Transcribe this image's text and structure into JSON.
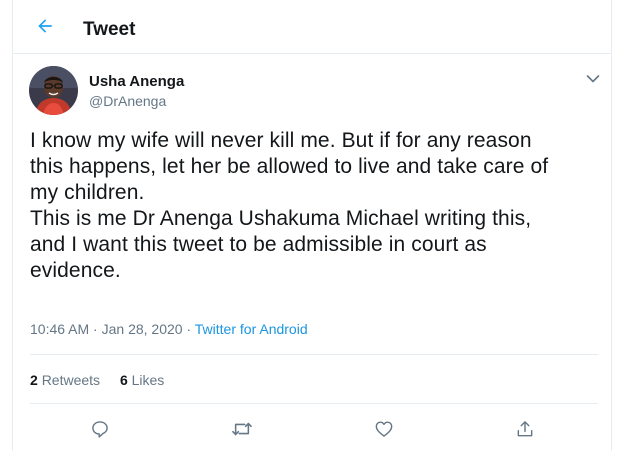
{
  "header": {
    "title": "Tweet",
    "back_icon": "arrow-left-icon"
  },
  "author": {
    "name": "Usha Anenga",
    "handle": "@DrAnenga"
  },
  "tweet": {
    "text": "I know my wife will never kill me. But if for any reason\nthis happens, let her be allowed to live and take care of\nmy children.\nThis is me Dr Anenga Ushakuma Michael writing this,\nand I want this tweet to be admissible in court as\nevidence.",
    "time": "10:46 AM",
    "separator": "·",
    "date": "Jan 28, 2020",
    "source": "Twitter for Android"
  },
  "stats": {
    "retweets_count": "2",
    "retweets_label": "Retweets",
    "likes_count": "6",
    "likes_label": "Likes"
  },
  "actions": [
    "reply-icon",
    "retweet-icon",
    "like-icon",
    "share-icon"
  ],
  "colors": {
    "accent": "#1da1f2",
    "link": "#1b95e0",
    "secondary_text": "#657786",
    "border": "#e6ecf0"
  }
}
